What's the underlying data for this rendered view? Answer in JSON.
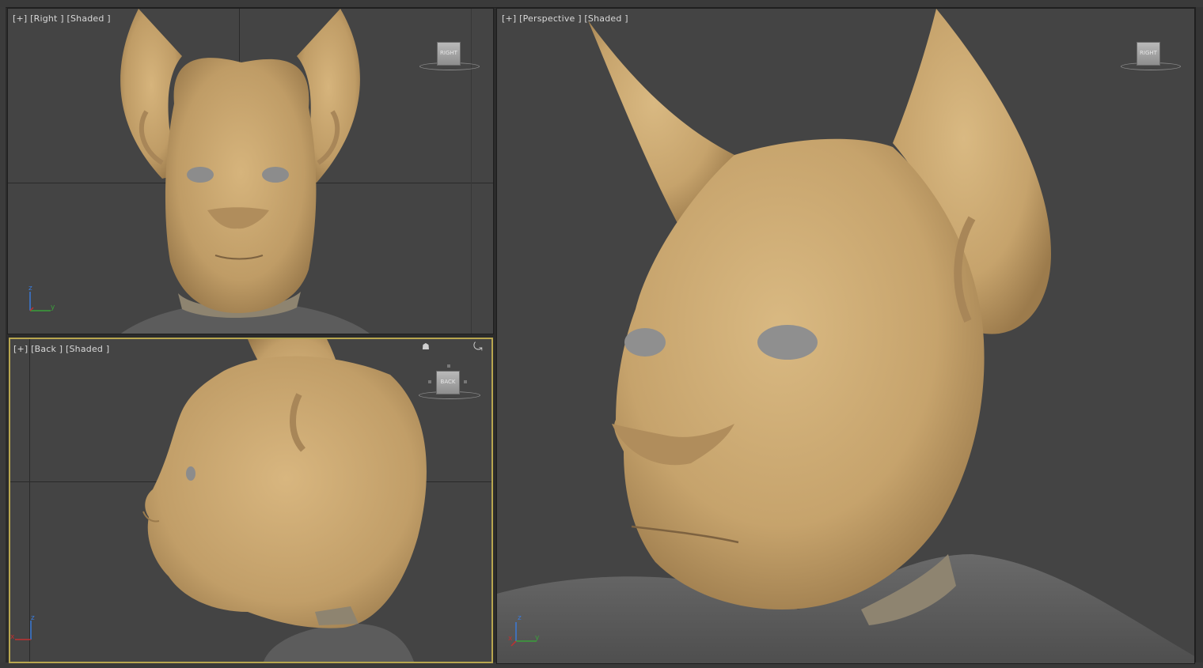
{
  "viewports": {
    "right": {
      "plus": "[+]",
      "view": "[Right ]",
      "shading": "[Shaded ]",
      "cube_face": "RIGHT"
    },
    "back": {
      "plus": "[+]",
      "view": "[Back ]",
      "shading": "[Shaded ]",
      "cube_face": "BACK"
    },
    "perspective": {
      "plus": "[+]",
      "view": "[Perspective ]",
      "shading": "[Shaded ]",
      "cube_face": "RIGHT"
    }
  },
  "axes": {
    "z": "z",
    "y": "y",
    "x": "x"
  },
  "icons": {
    "home": "home-icon",
    "orbit": "orbit-arrows-icon"
  },
  "colors": {
    "viewport_bg": "#444444",
    "active_border": "#b8a64f",
    "skin": "#c8a571",
    "shirt": "#5c5c5c"
  }
}
